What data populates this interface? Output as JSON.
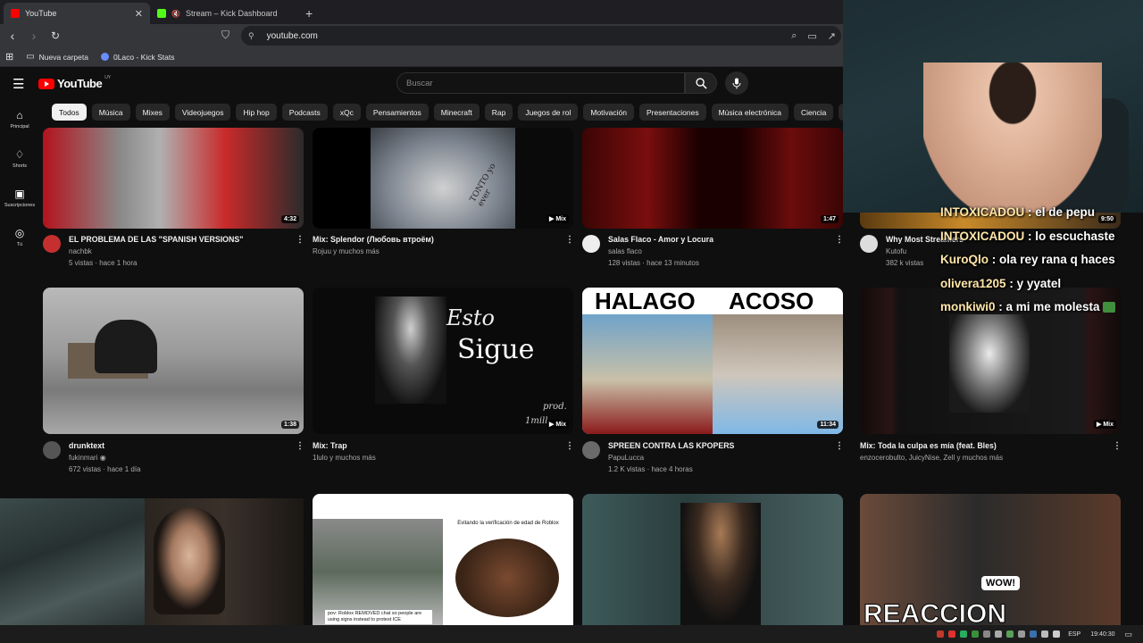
{
  "browser": {
    "tabs": [
      {
        "title": "YouTube",
        "active": true,
        "favicon_color": "#ff0000"
      },
      {
        "title": "Stream – Kick Dashboard",
        "active": false,
        "favicon_color": "#53fc18"
      }
    ],
    "url": "youtube.com",
    "bookmarks": [
      "Nueva carpeta",
      "0Laco - Kick Stats"
    ]
  },
  "youtube": {
    "logo_text": "YouTube",
    "country_code": "UY",
    "search_placeholder": "Buscar",
    "rail": [
      {
        "label": "Principal",
        "icon": "home-icon"
      },
      {
        "label": "Shorts",
        "icon": "shorts-icon"
      },
      {
        "label": "Suscripciones",
        "icon": "subscriptions-icon"
      },
      {
        "label": "Tú",
        "icon": "you-icon"
      }
    ],
    "chips": [
      "Todos",
      "Música",
      "Mixes",
      "Videojuegos",
      "Hip hop",
      "Podcasts",
      "xQc",
      "Pensamientos",
      "Minecraft",
      "Rap",
      "Juegos de rol",
      "Motivación",
      "Presentaciones",
      "Música electrónica",
      "Ciencia",
      "S"
    ],
    "videos": [
      {
        "title": "EL PROBLEMA DE LAS \"SPANISH VERSIONS\"",
        "channel": "nachbk",
        "stats": "5 vistas · hace 1 hora",
        "duration": "4:32"
      },
      {
        "title": "Mix: Splendor (Любовь втроём)",
        "channel": "Rojuu y muchos más",
        "stats": "",
        "duration": "Mix",
        "thumb_text": "TONTO yo ever"
      },
      {
        "title": "Salas Flaco - Amor y Locura",
        "channel": "salas flaco",
        "stats": "128 vistas · hace 13 minutos",
        "duration": "1:47"
      },
      {
        "title": "Why Most Streamers",
        "channel": "Kutofu",
        "stats": "382 k vistas",
        "duration": "9:50"
      },
      {
        "title": "drunktext",
        "channel": "fukinmari",
        "stats": "672 vistas · hace 1 día",
        "duration": "1:38"
      },
      {
        "title": "Mix: Trap",
        "channel": "1lulo y muchos más",
        "stats": "",
        "duration": "Mix",
        "thumb_text_1": "Esto",
        "thumb_text_2": "Sigue",
        "thumb_text_3": "prod.",
        "thumb_text_4": "1mill"
      },
      {
        "title": "SPREEN CONTRA LAS KPOPERS",
        "channel": "PapuLucca",
        "stats": "1.2 K vistas · hace 4 horas",
        "duration": "11:34",
        "thumb_text_1": "HALAGO",
        "thumb_text_2": "ACOSO"
      },
      {
        "title": "Mix: Toda la culpa es mía (feat. Bles)",
        "channel": "enzocerobulto, JuicyNise, Zell y muchos más",
        "stats": "",
        "duration": "Mix"
      },
      {
        "thumb_text_1": "Evitando la verificación de edad de Roblox",
        "thumb_text_2": "pov: Roblox REMOVED chat so people are using signs instead to protest ICE"
      },
      {
        "thumb_text_1": "WOW!",
        "thumb_text_2": "REACCION"
      }
    ]
  },
  "chat": [
    {
      "user": "INTOXICADOU",
      "msg": "el de pepu"
    },
    {
      "user": "INTOXICADOU",
      "msg": "lo escuchaste"
    },
    {
      "user": "KuroQlo",
      "msg": "ola rey rana q haces"
    },
    {
      "user": "olivera1205",
      "msg": "y yyatel"
    },
    {
      "user": "monkiwi0",
      "msg": "a mi me molesta"
    }
  ],
  "taskbar": {
    "lang": "ESP",
    "time": "19:40:30"
  }
}
